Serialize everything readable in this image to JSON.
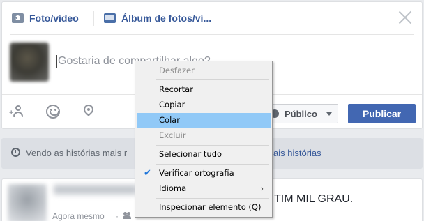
{
  "composer": {
    "tabs": [
      {
        "label": "Foto/vídeo",
        "icon": "camera-icon"
      },
      {
        "label": "Álbum de fotos/ví...",
        "icon": "photo-album-icon"
      }
    ],
    "placeholder": "Gostaria de compartilhar algo?",
    "privacy_label": "Público",
    "publish_label": "Publicar"
  },
  "stories": {
    "text": "Vendo as histórias mais r",
    "right_text": "ais histórias"
  },
  "feed": {
    "time": "Agora mesmo",
    "dot": "·",
    "status": "TIM MIL GRAU."
  },
  "context_menu": {
    "items": [
      {
        "label": "Desfazer",
        "enabled": false
      },
      {
        "label": "Recortar",
        "enabled": true
      },
      {
        "label": "Copiar",
        "enabled": true
      },
      {
        "label": "Colar",
        "enabled": true,
        "highlighted": true
      },
      {
        "label": "Excluir",
        "enabled": false
      },
      {
        "label": "Selecionar tudo",
        "enabled": true
      },
      {
        "label": "Verificar ortografia",
        "enabled": true,
        "checked": true
      },
      {
        "label": "Idioma",
        "enabled": true,
        "submenu": true
      },
      {
        "label": "Inspecionar elemento (Q)",
        "enabled": true
      }
    ]
  },
  "colors": {
    "link": "#365899",
    "publish_bg": "#4267b2",
    "menu_highlight": "#91c9f7",
    "page_bg": "#e9ebee"
  }
}
